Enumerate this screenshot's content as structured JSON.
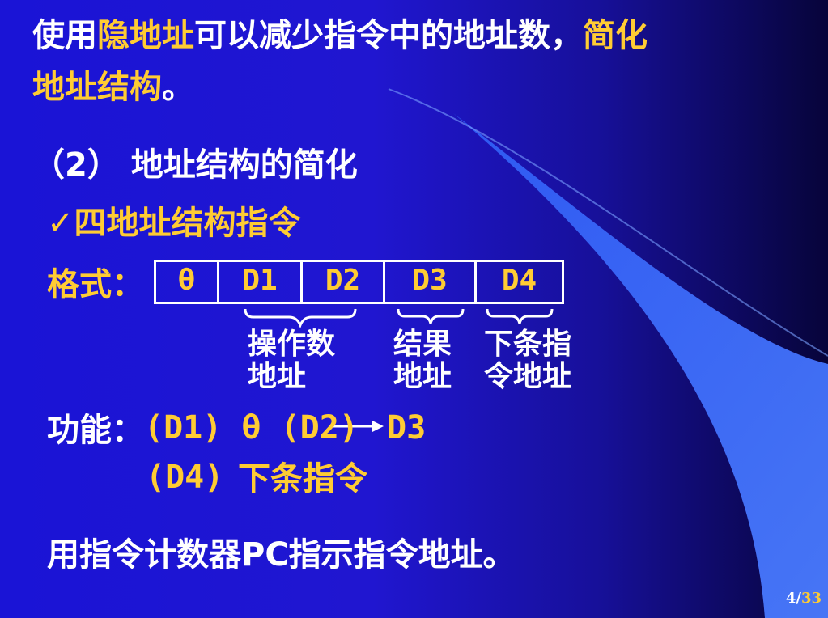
{
  "intro": {
    "p1": "使用",
    "p2": "隐地址",
    "p3": "可以减少指令中的地址数，",
    "p4": "简化",
    "p5": "地址结构",
    "p6": "。"
  },
  "section_title": "（2） 地址结构的简化",
  "subsection": "✓四地址结构指令",
  "format": {
    "label": "格式：",
    "cells": [
      "θ",
      "D1",
      "D2",
      "D3",
      "D4"
    ],
    "brace_labels": [
      {
        "line1": "操作数",
        "line2": "地址"
      },
      {
        "line1": "结果",
        "line2": "地址"
      },
      {
        "line1": "下条指",
        "line2": "令地址"
      }
    ]
  },
  "function": {
    "label": "功能：",
    "expr_left": "(D1) θ (D2)",
    "expr_right": "D3",
    "line2_operand": "(D4)",
    "line2_text": "下条指令"
  },
  "bottom_note": "用指令计数器PC指示指令地址。",
  "page": {
    "current": "4/",
    "total": "33"
  },
  "colors": {
    "text": "#ffffff",
    "highlight": "#ffcc33",
    "background": "#1a14d6",
    "curve": "#3b6cff"
  }
}
